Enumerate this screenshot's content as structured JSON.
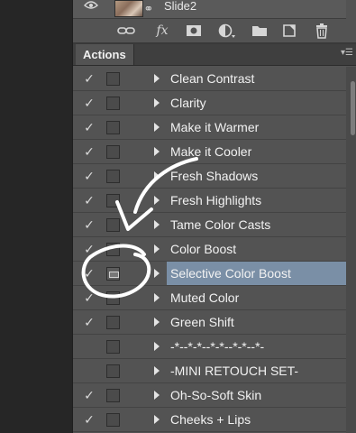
{
  "layers": {
    "layer_name": "Slide2"
  },
  "toolbar_icons": [
    "link-icon",
    "fx-icon",
    "mask-icon",
    "adjustment-icon",
    "folder-icon",
    "new-layer-icon",
    "trash-icon"
  ],
  "fx_label": "fx",
  "actions": {
    "tab_label": "Actions",
    "items": [
      {
        "name": "Clean Contrast",
        "checked": true,
        "dialog": false,
        "selected": false
      },
      {
        "name": "Clarity",
        "checked": true,
        "dialog": false,
        "selected": false
      },
      {
        "name": "Make it Warmer",
        "checked": true,
        "dialog": false,
        "selected": false
      },
      {
        "name": "Make it Cooler",
        "checked": true,
        "dialog": false,
        "selected": false
      },
      {
        "name": "Fresh Shadows",
        "checked": true,
        "dialog": false,
        "selected": false
      },
      {
        "name": "Fresh Highlights",
        "checked": true,
        "dialog": false,
        "selected": false
      },
      {
        "name": "Tame Color Casts",
        "checked": true,
        "dialog": false,
        "selected": false
      },
      {
        "name": "Color Boost",
        "checked": true,
        "dialog": false,
        "selected": false
      },
      {
        "name": "Selective Color Boost",
        "checked": true,
        "dialog": true,
        "selected": true
      },
      {
        "name": "Muted Color",
        "checked": true,
        "dialog": false,
        "selected": false
      },
      {
        "name": "Green Shift",
        "checked": true,
        "dialog": false,
        "selected": false
      },
      {
        "name": "-*--*-*--*-*--*-*--*-",
        "checked": false,
        "dialog": false,
        "selected": false
      },
      {
        "name": "-MINI RETOUCH SET-",
        "checked": false,
        "dialog": false,
        "selected": false
      },
      {
        "name": "Oh-So-Soft Skin",
        "checked": true,
        "dialog": false,
        "selected": false
      },
      {
        "name": "Cheeks + Lips",
        "checked": true,
        "dialog": false,
        "selected": false
      }
    ]
  },
  "colors": {
    "selected_row": "#7a8fa6",
    "panel_bg": "#535353",
    "annotation": "#ffffff"
  }
}
